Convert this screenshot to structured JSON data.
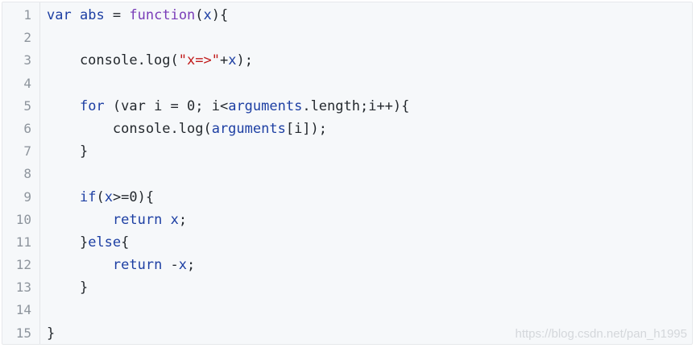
{
  "editor": {
    "lines": [
      {
        "number": "1",
        "tokens": [
          {
            "t": "var",
            "c": "keyword"
          },
          {
            "t": " ",
            "c": "plain"
          },
          {
            "t": "abs",
            "c": "name"
          },
          {
            "t": " = ",
            "c": "plain"
          },
          {
            "t": "function",
            "c": "func"
          },
          {
            "t": "(",
            "c": "plain"
          },
          {
            "t": "x",
            "c": "param"
          },
          {
            "t": "){",
            "c": "plain"
          }
        ]
      },
      {
        "number": "2",
        "tokens": []
      },
      {
        "number": "3",
        "tokens": [
          {
            "t": "    console.log(",
            "c": "plain"
          },
          {
            "t": "\"x=>\"",
            "c": "string"
          },
          {
            "t": "+",
            "c": "plain"
          },
          {
            "t": "x",
            "c": "param"
          },
          {
            "t": ");",
            "c": "plain"
          }
        ]
      },
      {
        "number": "4",
        "tokens": []
      },
      {
        "number": "5",
        "tokens": [
          {
            "t": "    ",
            "c": "plain"
          },
          {
            "t": "for",
            "c": "keyword"
          },
          {
            "t": " (var i = 0; i<",
            "c": "plain"
          },
          {
            "t": "arguments",
            "c": "name"
          },
          {
            "t": ".length;i++){",
            "c": "plain"
          }
        ]
      },
      {
        "number": "6",
        "tokens": [
          {
            "t": "        console.log(",
            "c": "plain"
          },
          {
            "t": "arguments",
            "c": "name"
          },
          {
            "t": "[i]);",
            "c": "plain"
          }
        ]
      },
      {
        "number": "7",
        "tokens": [
          {
            "t": "    }",
            "c": "plain"
          }
        ]
      },
      {
        "number": "8",
        "tokens": []
      },
      {
        "number": "9",
        "tokens": [
          {
            "t": "    ",
            "c": "plain"
          },
          {
            "t": "if",
            "c": "keyword"
          },
          {
            "t": "(",
            "c": "plain"
          },
          {
            "t": "x",
            "c": "param"
          },
          {
            "t": ">=0){",
            "c": "plain"
          }
        ]
      },
      {
        "number": "10",
        "tokens": [
          {
            "t": "        ",
            "c": "plain"
          },
          {
            "t": "return",
            "c": "keyword"
          },
          {
            "t": " ",
            "c": "plain"
          },
          {
            "t": "x",
            "c": "param"
          },
          {
            "t": ";",
            "c": "plain"
          }
        ]
      },
      {
        "number": "11",
        "tokens": [
          {
            "t": "    }",
            "c": "plain"
          },
          {
            "t": "else",
            "c": "keyword"
          },
          {
            "t": "{",
            "c": "plain"
          }
        ]
      },
      {
        "number": "12",
        "tokens": [
          {
            "t": "        ",
            "c": "plain"
          },
          {
            "t": "return",
            "c": "keyword"
          },
          {
            "t": " -",
            "c": "plain"
          },
          {
            "t": "x",
            "c": "param"
          },
          {
            "t": ";",
            "c": "plain"
          }
        ]
      },
      {
        "number": "13",
        "tokens": [
          {
            "t": "    }",
            "c": "plain"
          }
        ]
      },
      {
        "number": "14",
        "tokens": []
      },
      {
        "number": "15",
        "tokens": [
          {
            "t": "}",
            "c": "plain"
          }
        ]
      }
    ]
  },
  "watermark": "https://blog.csdn.net/pan_h1995",
  "colors": {
    "background": "#f6f8fa",
    "line_number": "#8e959d",
    "keyword": "#1d3fa3",
    "function": "#7a3db8",
    "string": "#c11b1b",
    "text": "#24292e"
  }
}
